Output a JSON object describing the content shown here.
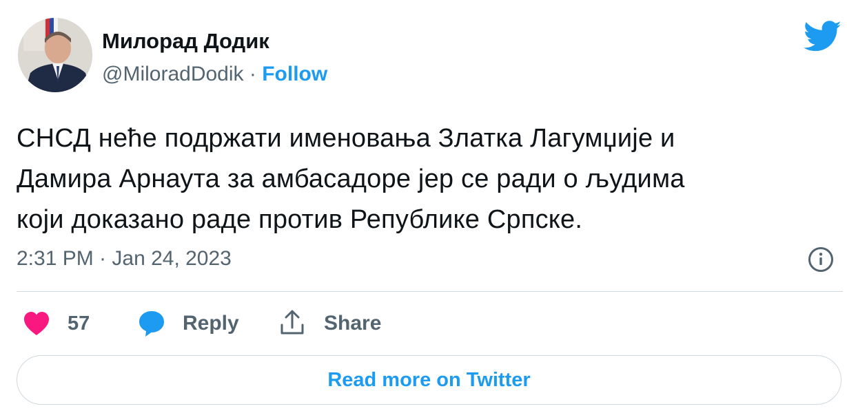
{
  "author": {
    "name": "Милорад Додик",
    "handle": "@MiloradDodik",
    "separator": "·",
    "follow_label": "Follow"
  },
  "tweet": {
    "text_lines": [
      "СНСД неће подржати именовања Златка Лагумџије и",
      "Дамира Арнаута за амбасадоре јер се ради о људима",
      "који доказано раде против Републике Српске."
    ],
    "timestamp": "2:31 PM · Jan 24, 2023"
  },
  "actions": {
    "like_count": "57",
    "reply_label": "Reply",
    "share_label": "Share"
  },
  "read_more_label": "Read more on Twitter",
  "icons": {
    "logo": "twitter-bird-icon",
    "info": "info-icon",
    "like": "heart-icon",
    "reply": "speech-bubble-icon",
    "share": "share-arrow-icon"
  },
  "colors": {
    "accent": "#1d9bf0",
    "like": "#f91880",
    "secondary_text": "#536471",
    "primary_text": "#0f1419",
    "border": "#cfd9de"
  }
}
